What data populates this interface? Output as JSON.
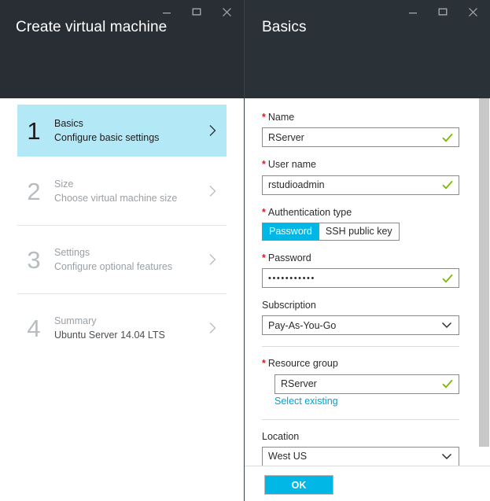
{
  "left_panel": {
    "title": "Create virtual machine",
    "window_controls": [
      {
        "name": "minimize",
        "glyph": "minimize-icon"
      },
      {
        "name": "maximize",
        "glyph": "maximize-icon"
      },
      {
        "name": "close",
        "glyph": "close-icon"
      }
    ],
    "steps": [
      {
        "number": "1",
        "title": "Basics",
        "subtitle": "Configure basic settings",
        "state": "active"
      },
      {
        "number": "2",
        "title": "Size",
        "subtitle": "Choose virtual machine size",
        "state": "inactive"
      },
      {
        "number": "3",
        "title": "Settings",
        "subtitle": "Configure optional features",
        "state": "inactive"
      },
      {
        "number": "4",
        "title": "Summary",
        "subtitle": "Ubuntu Server 14.04 LTS",
        "state": "summary"
      }
    ]
  },
  "right_panel": {
    "title": "Basics",
    "window_controls": [
      {
        "name": "minimize",
        "glyph": "minimize-icon"
      },
      {
        "name": "maximize",
        "glyph": "maximize-icon"
      },
      {
        "name": "close",
        "glyph": "close-icon"
      }
    ],
    "form": {
      "name": {
        "label": "Name",
        "required": true,
        "value": "RServer",
        "valid": true
      },
      "user_name": {
        "label": "User name",
        "required": true,
        "value": "rstudioadmin",
        "valid": true
      },
      "auth_type": {
        "label": "Authentication type",
        "required": true,
        "options": [
          "Password",
          "SSH public key"
        ],
        "selected": "Password"
      },
      "password": {
        "label": "Password",
        "required": true,
        "value": "•••••••••••",
        "valid": true
      },
      "subscription": {
        "label": "Subscription",
        "required": false,
        "value": "Pay-As-You-Go",
        "options": [
          "Pay-As-You-Go"
        ]
      },
      "resource_group": {
        "label": "Resource group",
        "required": true,
        "value": "RServer",
        "valid": true,
        "link": "Select existing"
      },
      "location": {
        "label": "Location",
        "required": false,
        "value": "West US",
        "options": [
          "West US"
        ]
      }
    },
    "footer": {
      "ok_label": "OK"
    }
  },
  "colors": {
    "titlebar": "#282e33",
    "accent_blue": "#00b7e5",
    "step_active": "#b3e9f7",
    "required_red": "#e81123",
    "valid_green": "#7ab800",
    "link_blue": "#00a1d6"
  }
}
